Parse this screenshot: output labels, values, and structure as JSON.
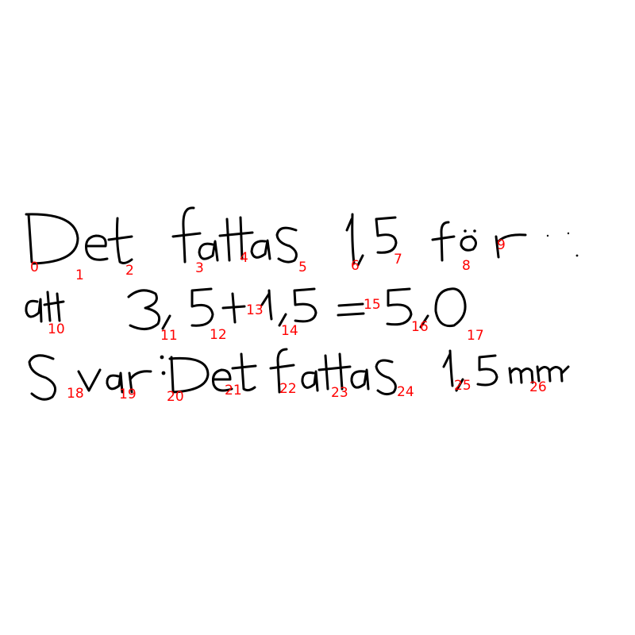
{
  "transcription": {
    "line1": "Det fattas 1,5 för",
    "line2": "att 3,5+1,5=5,0",
    "line3": "Svar: Det fattas 1,5mm"
  },
  "ink_color": "#000000",
  "label_color": "#ff0000",
  "stroke_indices": [
    "0",
    "1",
    "2",
    "3",
    "4",
    "5",
    "6",
    "7",
    "8",
    "9",
    "10",
    "11",
    "12",
    "13",
    "14",
    "15",
    "16",
    "17",
    "18",
    "19",
    "20",
    "21",
    "22",
    "23",
    "24",
    "25",
    "26"
  ]
}
